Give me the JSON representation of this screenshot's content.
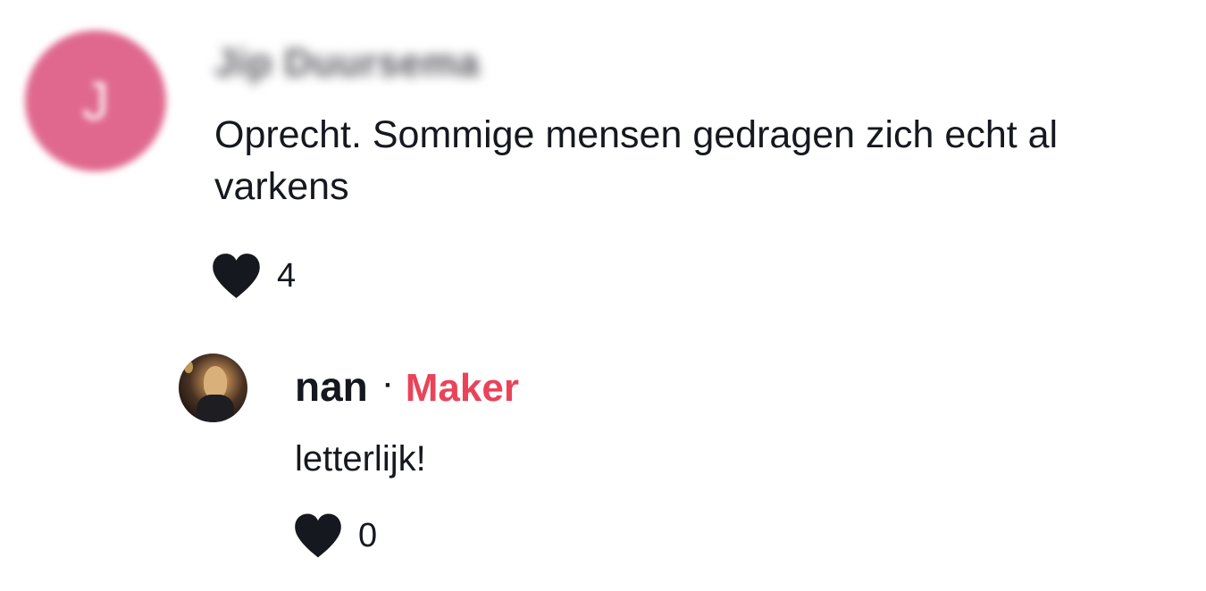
{
  "comment": {
    "avatar_initial": "J",
    "username": "Jip Duursema",
    "text": "Oprecht. Sommige mensen gedragen zich echt al varkens",
    "likes": "4"
  },
  "reply": {
    "username": "nan",
    "separator": "·",
    "badge": "Maker",
    "text": "letterlijk!",
    "likes": "0"
  },
  "colors": {
    "avatar_initial_bg": "#e0688f",
    "creator_badge": "#ea4359",
    "text": "#16181f"
  },
  "icons": {
    "like": "heart-icon"
  }
}
